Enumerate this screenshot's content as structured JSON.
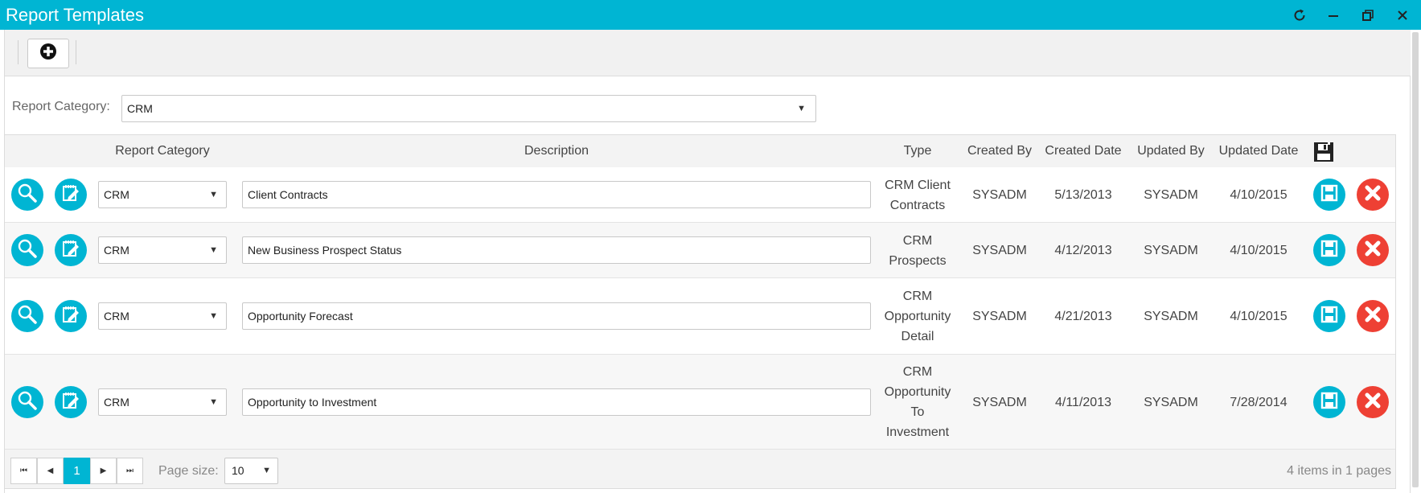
{
  "window": {
    "title": "Report Templates",
    "controls": [
      "refresh-icon",
      "minimize-icon",
      "restore-icon",
      "close-icon"
    ]
  },
  "toolbar": {
    "add_icon": "plus-circle-icon"
  },
  "filter": {
    "label": "Report Category:",
    "value": "CRM"
  },
  "grid": {
    "columns": {
      "category": "Report Category",
      "description": "Description",
      "type": "Type",
      "created_by": "Created By",
      "created_date": "Created Date",
      "updated_by": "Updated By",
      "updated_date": "Updated Date",
      "save_icon": "save-all-icon"
    },
    "rows": [
      {
        "category": "CRM",
        "description": "Client Contracts",
        "type": [
          "CRM Client",
          "Contracts"
        ],
        "created_by": "SYSADM",
        "created_date": "5/13/2013",
        "updated_by": "SYSADM",
        "updated_date": "4/10/2015"
      },
      {
        "category": "CRM",
        "description": "New Business Prospect Status",
        "type": [
          "CRM",
          "Prospects"
        ],
        "created_by": "SYSADM",
        "created_date": "4/12/2013",
        "updated_by": "SYSADM",
        "updated_date": "4/10/2015"
      },
      {
        "category": "CRM",
        "description": "Opportunity Forecast",
        "type": [
          "CRM",
          "Opportunity",
          "Detail"
        ],
        "created_by": "SYSADM",
        "created_date": "4/21/2013",
        "updated_by": "SYSADM",
        "updated_date": "4/10/2015"
      },
      {
        "category": "CRM",
        "description": "Opportunity to Investment",
        "type": [
          "CRM",
          "Opportunity",
          "To",
          "Investment"
        ],
        "created_by": "SYSADM",
        "created_date": "4/11/2013",
        "updated_by": "SYSADM",
        "updated_date": "7/28/2014"
      }
    ],
    "row_icons": {
      "view": "magnifier-icon",
      "edit": "edit-notepad-icon",
      "save": "save-icon",
      "delete": "delete-x-icon"
    }
  },
  "pager": {
    "current_page": "1",
    "page_size_label": "Page size:",
    "page_size": "10",
    "info": "4 items in 1 pages"
  },
  "colors": {
    "accent": "#00b5d3",
    "delete": "#ee4034",
    "header_bg": "#f3f3f3"
  }
}
